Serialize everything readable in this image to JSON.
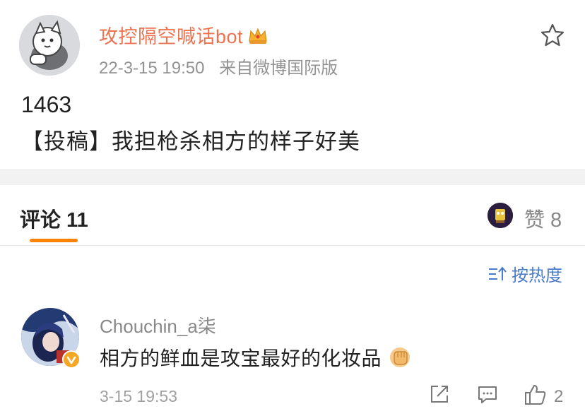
{
  "post": {
    "author": "攻控隔空喊话bot",
    "time": "22-3-15 19:50",
    "source": "来自微博国际版",
    "number": "1463",
    "text": "【投稿】我担枪杀相方的样子好美",
    "icons": {
      "crown": "crown-icon",
      "favorite": "star-icon"
    }
  },
  "tabs": {
    "comments_label": "评论 11",
    "likes_label": "赞 8"
  },
  "sort": {
    "label": "按热度",
    "icon": "sort-icon"
  },
  "comments": [
    {
      "user": "Chouchin_a柒",
      "text": "相方的鲜血是攻宝最好的化妆品",
      "time": "3-15 19:53",
      "like_count": "2",
      "emoji": "fist-emoji",
      "verified_color": "#f5a623"
    }
  ],
  "colors": {
    "accent": "#ff8200",
    "author": "#eb7350",
    "link": "#4a7cc9"
  }
}
